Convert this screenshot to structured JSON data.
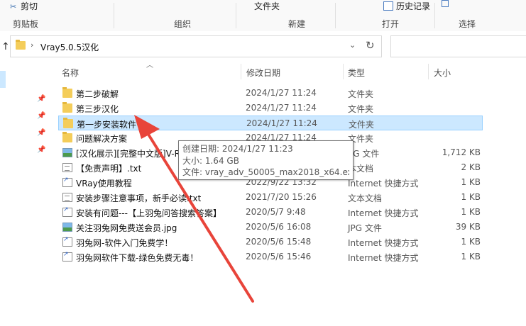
{
  "ribbon": {
    "cut_label": "剪切",
    "open_folder_label": "文件夹",
    "history_label": "历史记录",
    "groups": {
      "clipboard": "剪贴板",
      "organize": "组织",
      "new": "新建",
      "open": "打开",
      "select": "选择"
    }
  },
  "address": {
    "path": "Vray5.0.5汉化"
  },
  "columns": {
    "name": "名称",
    "date": "修改日期",
    "type": "类型",
    "size": "大小"
  },
  "files": [
    {
      "name": "第二步破解",
      "date": "2024/1/27 11:24",
      "type": "文件夹",
      "size": "",
      "icon": "folder-icon"
    },
    {
      "name": "第三步汉化",
      "date": "2024/1/27 11:24",
      "type": "文件夹",
      "size": "",
      "icon": "folder-icon"
    },
    {
      "name": "第一步安装软件",
      "date": "2024/1/27 11:24",
      "type": "文件夹",
      "size": "",
      "icon": "folder-icon"
    },
    {
      "name": "问题解决方案",
      "date": "2024/1/27 11:24",
      "type": "文件夹",
      "size": "",
      "icon": "folder-icon"
    },
    {
      "name": "[汉化展示][完整中文版]V-R",
      "date": "",
      "type": "PG 文件",
      "size": "1,712 KB",
      "icon": "image-icon"
    },
    {
      "name": "【免责声明】.txt",
      "date": "",
      "type": "本文档",
      "size": "2 KB",
      "icon": "text-file-icon"
    },
    {
      "name": "VRay使用教程",
      "date": "2022/9/22 13:32",
      "type": "Internet 快捷方式",
      "size": "1 KB",
      "icon": "shortcut-icon"
    },
    {
      "name": "安装步骤注意事项，新手必读.txt",
      "date": "2021/7/20 15:26",
      "type": "文本文档",
      "size": "1 KB",
      "icon": "text-file-icon"
    },
    {
      "name": "安装有问题---【上羽兔问答搜索答案】",
      "date": "2020/5/7 9:48",
      "type": "Internet 快捷方式",
      "size": "1 KB",
      "icon": "shortcut-icon"
    },
    {
      "name": "关注羽兔网免费送会员.jpg",
      "date": "2020/5/6 16:08",
      "type": "JPG 文件",
      "size": "39 KB",
      "icon": "image-icon"
    },
    {
      "name": "羽兔网-软件入门免费学！",
      "date": "2020/5/6 15:48",
      "type": "Internet 快捷方式",
      "size": "1 KB",
      "icon": "shortcut-icon"
    },
    {
      "name": "羽兔网软件下载-绿色免费无毒！",
      "date": "2020/5/6 15:46",
      "type": "Internet 快捷方式",
      "size": "1 KB",
      "icon": "shortcut-icon"
    }
  ],
  "tooltip": {
    "created": "创建日期: 2024/1/27 11:23",
    "size": "大小: 1.64 GB",
    "files": "文件: vray_adv_50005_max2018_x64.exe, ..."
  },
  "colors": {
    "selection": "#cce8ff",
    "selection_border": "#99d1ff",
    "arrow": "#e8443a",
    "folder": "#f4cd5a"
  }
}
